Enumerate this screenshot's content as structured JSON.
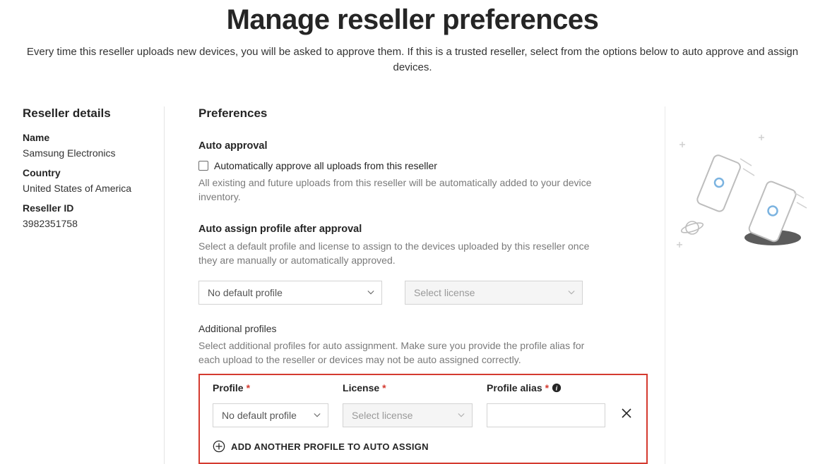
{
  "header": {
    "title": "Manage reseller preferences",
    "subtitle": "Every time this reseller uploads new devices, you will be asked to approve them. If this is a trusted reseller, select from the options below to auto approve and assign devices."
  },
  "reseller": {
    "section_title": "Reseller details",
    "name_label": "Name",
    "name_value": "Samsung Electronics",
    "country_label": "Country",
    "country_value": "United States of America",
    "id_label": "Reseller ID",
    "id_value": "3982351758"
  },
  "prefs": {
    "section_title": "Preferences",
    "auto_approval_title": "Auto approval",
    "auto_approval_checkbox_label": "Automatically approve all uploads from this reseller",
    "auto_approval_helper": "All existing and future uploads from this reseller will be automatically added to your device inventory.",
    "auto_assign_title": "Auto assign profile after approval",
    "auto_assign_helper": "Select a default profile and license to assign to the devices uploaded by this reseller once they are manually or automatically approved.",
    "default_profile_select": "No default profile",
    "default_license_select": "Select license",
    "additional_title": "Additional profiles",
    "additional_helper": "Select additional profiles for auto assignment. Make sure you provide the profile alias for each upload to the reseller or devices may not be auto assigned correctly.",
    "profile_label": "Profile",
    "license_label": "License",
    "alias_label": "Profile alias",
    "row_profile_value": "No default profile",
    "row_license_value": "Select license",
    "row_alias_value": "",
    "add_link_label": "ADD ANOTHER PROFILE TO AUTO ASSIGN"
  }
}
